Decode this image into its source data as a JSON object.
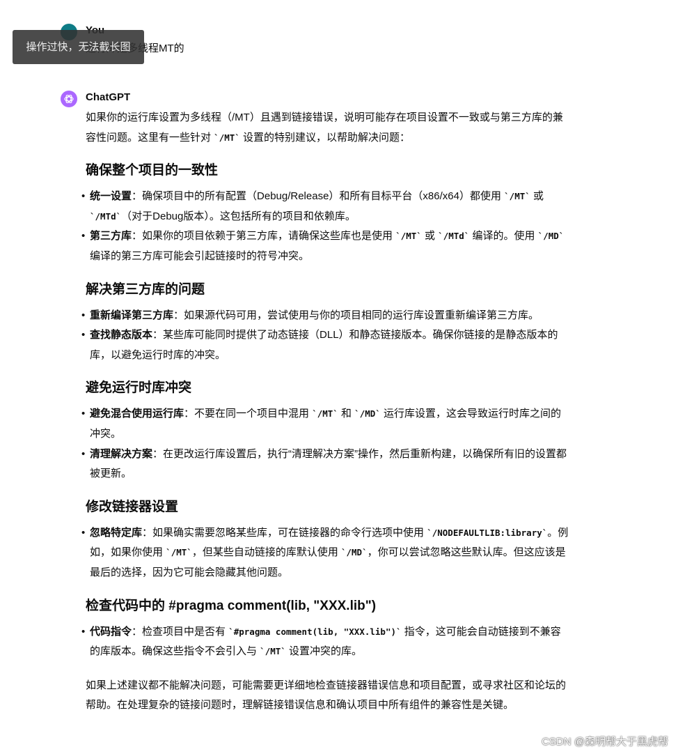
{
  "user": {
    "name": "You",
    "message": "运行库是多线程MT的"
  },
  "assistant": {
    "name": "ChatGPT",
    "intro": [
      {
        "t": "如果你的运行库设置为多线程（/MT）且遇到链接错误，说明可能存在项目设置不一致或与第三方库的兼容性问题。这里有一些针对 "
      },
      {
        "c": "`/MT`"
      },
      {
        "t": " 设置的特别建议，以帮助解决问题："
      }
    ],
    "sections": [
      {
        "heading": "确保整个项目的一致性",
        "items": [
          [
            {
              "b": "统一设置"
            },
            {
              "t": "：确保项目中的所有配置（Debug/Release）和所有目标平台（x86/x64）都使用 "
            },
            {
              "c": "`/MT`"
            },
            {
              "t": " 或 "
            },
            {
              "c": "`/MTd`"
            },
            {
              "t": "（对于Debug版本）。这包括所有的项目和依赖库。"
            }
          ],
          [
            {
              "b": "第三方库"
            },
            {
              "t": "：如果你的项目依赖于第三方库，请确保这些库也是使用 "
            },
            {
              "c": "`/MT`"
            },
            {
              "t": " 或 "
            },
            {
              "c": "`/MTd`"
            },
            {
              "t": " 编译的。使用 "
            },
            {
              "c": "`/MD`"
            },
            {
              "t": " 编译的第三方库可能会引起链接时的符号冲突。"
            }
          ]
        ]
      },
      {
        "heading": "解决第三方库的问题",
        "items": [
          [
            {
              "b": "重新编译第三方库"
            },
            {
              "t": "：如果源代码可用，尝试使用与你的项目相同的运行库设置重新编译第三方库。"
            }
          ],
          [
            {
              "b": "查找静态版本"
            },
            {
              "t": "：某些库可能同时提供了动态链接（DLL）和静态链接版本。确保你链接的是静态版本的库，以避免运行时库的冲突。"
            }
          ]
        ]
      },
      {
        "heading": "避免运行时库冲突",
        "items": [
          [
            {
              "b": "避免混合使用运行库"
            },
            {
              "t": "：不要在同一个项目中混用 "
            },
            {
              "c": "`/MT`"
            },
            {
              "t": " 和 "
            },
            {
              "c": "`/MD`"
            },
            {
              "t": " 运行库设置，这会导致运行时库之间的冲突。"
            }
          ],
          [
            {
              "b": "清理解决方案"
            },
            {
              "t": "：在更改运行库设置后，执行“清理解决方案”操作，然后重新构建，以确保所有旧的设置都被更新。"
            }
          ]
        ]
      },
      {
        "heading": "修改链接器设置",
        "items": [
          [
            {
              "b": "忽略特定库"
            },
            {
              "t": "：如果确实需要忽略某些库，可在链接器的命令行选项中使用 "
            },
            {
              "c": "`/NODEFAULTLIB:library`"
            },
            {
              "t": "。例如，如果你使用 "
            },
            {
              "c": "`/MT`"
            },
            {
              "t": "，但某些自动链接的库默认使用 "
            },
            {
              "c": "`/MD`"
            },
            {
              "t": "，你可以尝试忽略这些默认库。但这应该是最后的选择，因为它可能会隐藏其他问题。"
            }
          ]
        ]
      },
      {
        "heading": "检查代码中的 #pragma comment(lib, \"XXX.lib\")",
        "items": [
          [
            {
              "b": "代码指令"
            },
            {
              "t": "：检查项目中是否有 "
            },
            {
              "c": "`#pragma comment(lib, \"XXX.lib\")`"
            },
            {
              "t": " 指令，这可能会自动链接到不兼容的库版本。确保这些指令不会引入与 "
            },
            {
              "c": "`/MT`"
            },
            {
              "t": " 设置冲突的库。"
            }
          ]
        ]
      }
    ],
    "outro": "如果上述建议都不能解决问题，可能需要更详细地检查链接器错误信息和项目配置，或寻求社区和论坛的帮助。在处理复杂的链接问题时，理解链接错误信息和确认项目中所有组件的兼容性是关键。"
  },
  "toast": "操作过快，无法截长图",
  "watermark": "CSDN @森明帮大于黑虎帮",
  "colors": {
    "gpt_avatar": "#ab68ff",
    "user_avatar": "#0e7c86",
    "toast_bg": "#323232"
  }
}
